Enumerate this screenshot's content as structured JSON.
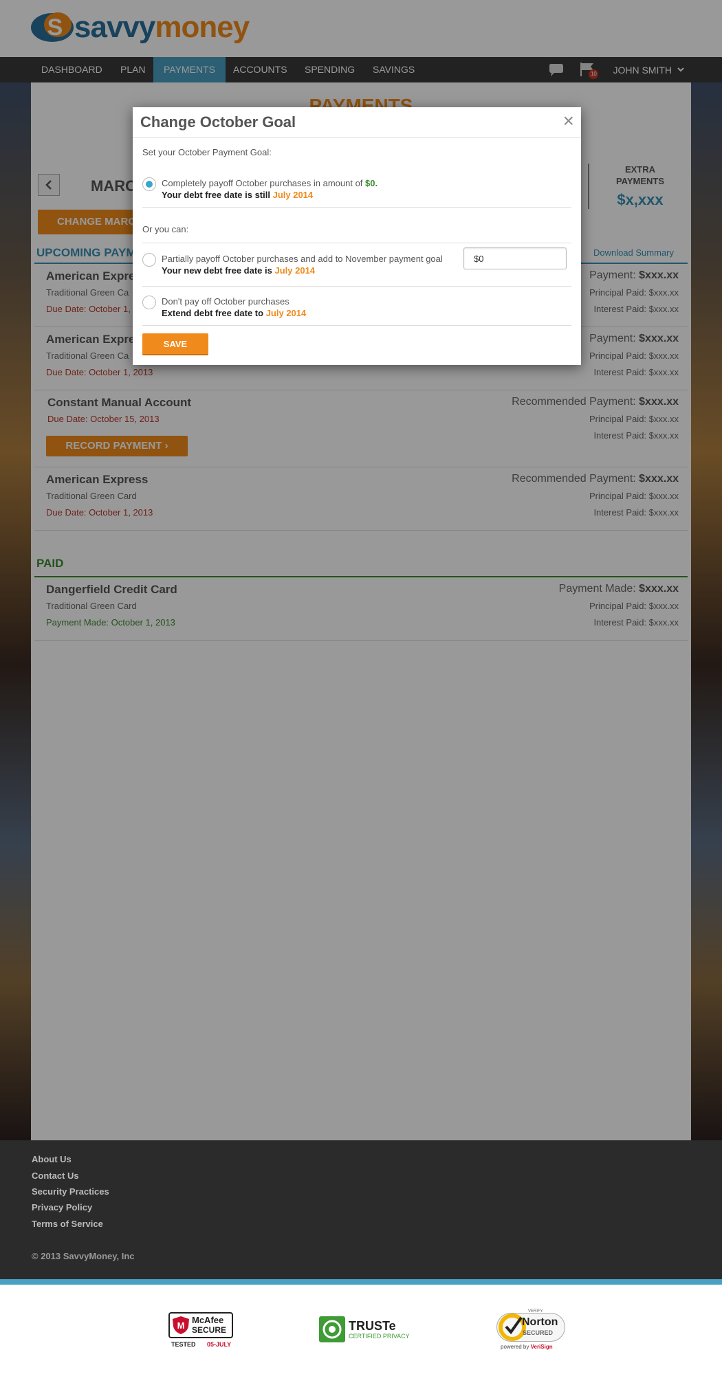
{
  "brand": {
    "name_part1": "savvy",
    "name_part2": "money",
    "primary": "#2a6f9b",
    "accent": "#f08a1c"
  },
  "nav": {
    "items": [
      "DASHBOARD",
      "PLAN",
      "PAYMENTS",
      "ACCOUNTS",
      "SPENDING",
      "SAVINGS"
    ],
    "active": "PAYMENTS",
    "notification_count": "10",
    "user": "JOHN SMITH"
  },
  "page": {
    "title": "PAYMENTS",
    "month_label": "MARC",
    "change_button": "CHANGE MARC",
    "extra_payments_label": "EXTRA PAYMENTS",
    "extra_payments_value": "$x,xxx",
    "upcoming_title": "UPCOMING PAYM",
    "download_link": "Download Summary",
    "paid_title": "PAID"
  },
  "upcoming": [
    {
      "name": "American Expre",
      "sub": "Traditional Green Ca",
      "due": "Due Date: October 1,",
      "rec_label": "Payment:",
      "rec_value": "$xxx.xx",
      "principal": "Principal Paid: $xxx.xx",
      "interest": "Interest Paid: $xxx.xx"
    },
    {
      "name": "American Expre",
      "sub": "Traditional Green Ca",
      "due": "Due Date: October 1, 2013",
      "rec_label": "Payment:",
      "rec_value": "$xxx.xx",
      "principal": "Principal Paid: $xxx.xx",
      "interest": "Interest Paid: $xxx.xx"
    },
    {
      "name": "Constant Manual Account",
      "due": "Due Date: October 15, 2013",
      "button": "RECORD PAYMENT",
      "rec_label": "Recommended Payment:",
      "rec_value": "$xxx.xx",
      "principal": "Principal Paid: $xxx.xx",
      "interest": "Interest Paid: $xxx.xx"
    },
    {
      "name": "American Express",
      "sub": "Traditional Green Card",
      "due": "Due Date: October 1, 2013",
      "rec_label": "Recommended Payment:",
      "rec_value": "$xxx.xx",
      "principal": "Principal Paid: $xxx.xx",
      "interest": "Interest Paid: $xxx.xx"
    }
  ],
  "paid": [
    {
      "name": "Dangerfield Credit Card",
      "sub": "Traditional Green Card",
      "due": "Payment Made: October 1, 2013",
      "rec_label": "Payment Made:",
      "rec_value": "$xxx.xx",
      "principal": "Principal Paid: $xxx.xx",
      "interest": "Interest Paid: $xxx.xx"
    }
  ],
  "modal": {
    "title": "Change October Goal",
    "close": "×",
    "intro": "Set your October Payment Goal:",
    "option1_text": "Completely payoff October purchases in amount of",
    "option1_amount": "$0.",
    "option1_sub": "Your debt free date is still",
    "option1_date": "July 2014",
    "or_text": "Or you can:",
    "option2_text": "Partially payoff October purchases and add to November payment goal",
    "option2_sub": "Your new debt free date is",
    "option2_date": "July 2014",
    "option2_input_value": "$0",
    "option3_text": "Don't pay off October purchases",
    "option3_sub": "Extend debt free date to",
    "option3_date": "July 2014",
    "save": "SAVE",
    "selected_option": 1
  },
  "footer": {
    "links": [
      "About Us",
      "Contact Us",
      "Security Practices",
      "Privacy Policy",
      "Terms of Service"
    ],
    "copyright": "© 2013 SavvyMoney, Inc"
  },
  "badges": {
    "mcafee_name": "McAfee",
    "mcafee_secure": "SECURE",
    "mcafee_tested": "TESTED",
    "mcafee_date": "05-JULY",
    "truste_name": "TRUSTe",
    "truste_sub": "CERTIFIED PRIVACY",
    "norton_verify": "VERIFY",
    "norton_name": "Norton",
    "norton_secured": "SECURED",
    "norton_powered": "powered by",
    "norton_verisign": "VeriSign"
  }
}
